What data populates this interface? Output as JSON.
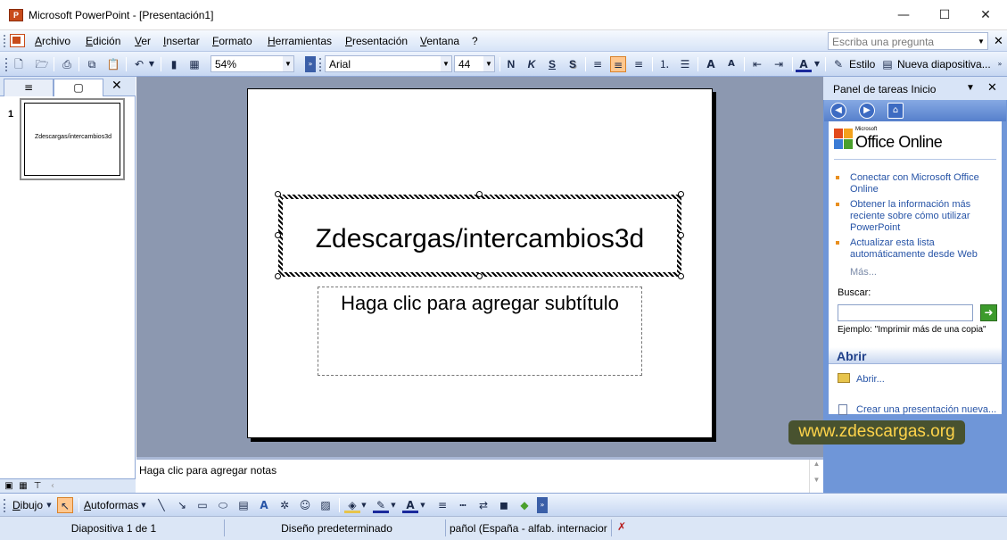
{
  "window": {
    "title": "Microsoft PowerPoint - [Presentación1]",
    "app_icon": "P",
    "min_glyph": "—",
    "max_glyph": "☐",
    "close_glyph": "✕"
  },
  "menubar": {
    "items": [
      "Archivo",
      "Edición",
      "Ver",
      "Insertar",
      "Formato",
      "Herramientas",
      "Presentación",
      "Ventana",
      "?"
    ],
    "ask_placeholder": "Escriba una pregunta",
    "close_glyph": "✕"
  },
  "toolbar": {
    "zoom": "54%",
    "font": "Arial",
    "size": "44",
    "bold": "N",
    "italic": "K",
    "underline": "S",
    "shadow": "S",
    "style_label": "Estilo",
    "new_slide_label": "Nueva diapositiva..."
  },
  "left_pane": {
    "tab_outline_icon": "≡",
    "tab_slides_icon": "▢",
    "close_glyph": "✕",
    "slide_number": "1",
    "thumb_text": "Zdescargas/intercambios3d"
  },
  "slide": {
    "title": "Zdescargas/intercambios3d",
    "subtitle_placeholder": "Haga clic para agregar subtítulo"
  },
  "notes": {
    "placeholder": "Haga clic para agregar notas"
  },
  "task_pane": {
    "title": "Panel de tareas Inicio",
    "close_glyph": "✕",
    "office_small": "Microsoft",
    "office_text": "Office Online",
    "links": [
      "Conectar con Microsoft Office Online",
      "Obtener la información más reciente sobre cómo utilizar PowerPoint",
      "Actualizar esta lista automáticamente desde Web"
    ],
    "more": "Más...",
    "search_label": "Buscar:",
    "go_glyph": "➜",
    "example": "Ejemplo:  \"Imprimir más de una copia\"",
    "open_heading": "Abrir",
    "open_link": "Abrir...",
    "new_link": "Crear una presentación nueva..."
  },
  "watermark": "www.zdescargas.org",
  "drawing_toolbar": {
    "draw_label": "Dibujo",
    "autoshapes_label": "Autoformas"
  },
  "status": {
    "slide": "Diapositiva 1 de 1",
    "design": "Diseño predeterminado",
    "language": "pañol (España - alfab. internacior"
  },
  "colors": {
    "accent": "#6f96d8",
    "toolbar": "#c6d7f2",
    "canvas": "#8c98b0",
    "watermark_bg": "#48522f",
    "watermark_text": "#ffd44a",
    "link": "#2653a6"
  },
  "icons": [
    "app-icon",
    "new-icon",
    "open-icon",
    "save-icon",
    "print-icon",
    "copy-icon",
    "paste-icon",
    "undo-icon",
    "chart-icon",
    "table-icon",
    "bold-icon",
    "italic-icon",
    "underline-icon",
    "shadow-icon",
    "align-left-icon",
    "align-center-icon",
    "align-right-icon",
    "numbering-icon",
    "bullets-icon",
    "increase-font-icon",
    "decrease-font-icon",
    "font-color-icon",
    "back-icon",
    "forward-icon",
    "home-icon",
    "office-logo-icon",
    "folder-icon",
    "new-document-icon",
    "go-arrow-icon",
    "pointer-icon",
    "line-icon",
    "arrow-icon",
    "rectangle-icon",
    "oval-icon",
    "textbox-icon",
    "wordart-icon",
    "clipart-icon",
    "picture-icon",
    "fill-color-icon",
    "line-color-icon",
    "spell-check-icon"
  ]
}
